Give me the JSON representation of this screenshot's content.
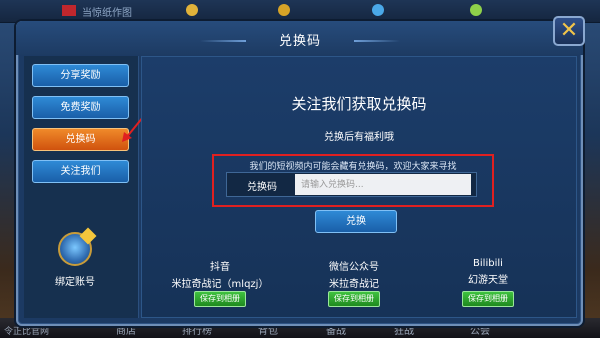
{
  "background": {
    "server_name": "当惊纸作图",
    "bottom_tabs": [
      "商店",
      "排行榜",
      "背包",
      "备战",
      "狂战",
      "公会"
    ],
    "corner_label": "令正比官网"
  },
  "dialog": {
    "title": "兑换码",
    "close_icon": "close-x-icon"
  },
  "sidebar": {
    "items": [
      {
        "label": "分享奖励",
        "active": false
      },
      {
        "label": "免费奖励",
        "active": false
      },
      {
        "label": "兑换码",
        "active": true
      },
      {
        "label": "关注我们",
        "active": false
      }
    ],
    "bind_account_label": "绑定账号"
  },
  "main": {
    "headline": "关注我们获取兑换码",
    "subtitle": "兑换后有福利哦",
    "hint": "我们的短视频内可能会藏有兑换码，欢迎大家来寻找",
    "code_label": "兑换码",
    "code_placeholder": "请输入兑换码...",
    "code_value": "",
    "redeem_label": "兑换"
  },
  "socials": [
    {
      "platform": "抖音",
      "account": "米拉奇战记（mlqzj）",
      "save_label": "保存到相册"
    },
    {
      "platform": "微信公众号",
      "account": "米拉奇战记",
      "save_label": "保存到相册"
    },
    {
      "platform": "Bilibili",
      "account": "幻游天堂",
      "save_label": "保存到相册"
    }
  ],
  "colors": {
    "accent_orange": "#e06a1a",
    "button_blue": "#1f6fbe",
    "save_green": "#2aa52a",
    "annotation_red": "#e02020",
    "close_gold": "#f1c44a"
  }
}
